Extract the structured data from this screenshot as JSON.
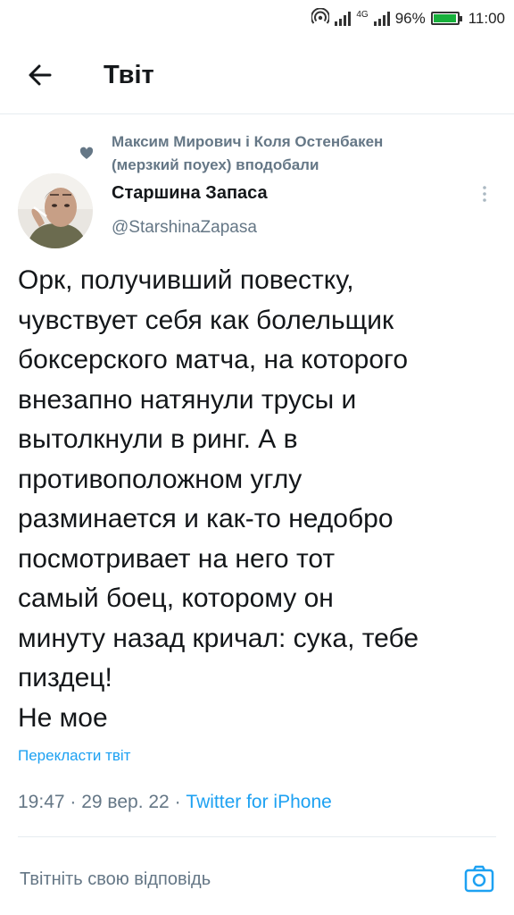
{
  "status_bar": {
    "battery_percent": "96%",
    "battery_level": 0.96,
    "network": "4G",
    "time": "11:00"
  },
  "header": {
    "title": "Твіт"
  },
  "tweet": {
    "liked_by": "Максим Мирович і Коля Остенбакен (мерзкий поуех) вподобали",
    "author_name": "Старшина Запаса",
    "author_handle": "@StarshinaZapasa",
    "text": "Орк, получивший повестку,\nчувствует себя как болельщик\nбоксерского матча, на которого\nвнезапно натянули трусы и\nвытолкнули в ринг. А в\nпротивоположном углу\nразминается и как-то недобро\nпосмотривает на него тот\nсамый боец, которому он\nминуту назад кричал: сука, тебе\nпиздец!\nНе мое",
    "translate_label": "Перекласти твіт",
    "time": "19:47",
    "date": "29 вер. 22",
    "source": "Twitter for iPhone"
  },
  "reply": {
    "placeholder": "Твітніть свою відповідь"
  },
  "colors": {
    "link": "#1da1f2",
    "secondary_text": "#657786",
    "battery": "#17b03b"
  },
  "icons": [
    "wifi-hotspot-icon",
    "signal-icon",
    "battery-icon",
    "back-arrow-icon",
    "heart-icon",
    "more-vertical-icon",
    "camera-icon"
  ]
}
